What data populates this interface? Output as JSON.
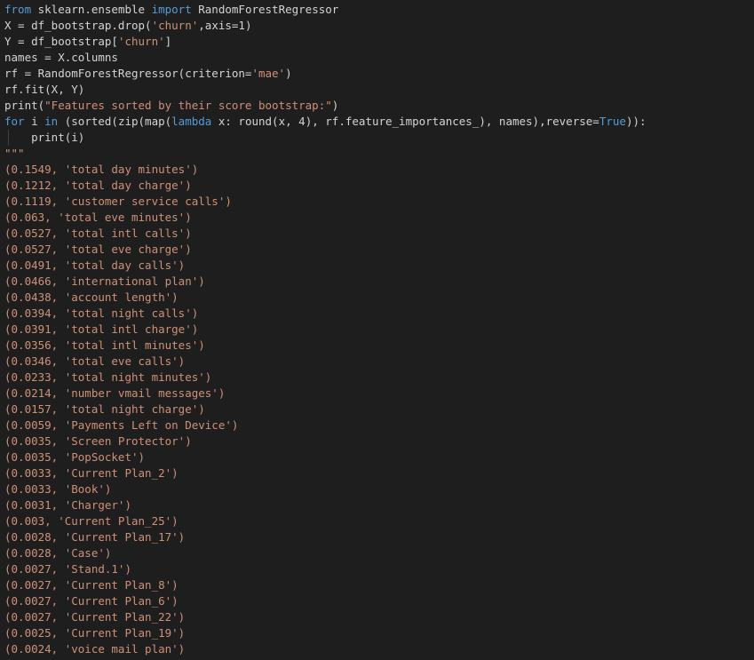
{
  "code": {
    "l1": {
      "kw1": "from",
      "mod": " sklearn.ensemble ",
      "kw2": "import",
      "name": " RandomForestRegressor"
    },
    "l2": {
      "a": "X = df_bootstrap.drop(",
      "s": "'churn'",
      "b": ",axis=",
      "n": "1",
      "c": ")"
    },
    "l3": {
      "a": "Y = df_bootstrap[",
      "s": "'churn'",
      "b": "]"
    },
    "l4": {
      "a": "names = X.columns"
    },
    "l5": {
      "a": "rf = RandomForestRegressor(criterion=",
      "s": "'mae'",
      "b": ")"
    },
    "l6": {
      "a": "rf.fit(X, Y)"
    },
    "l7": {
      "a": "print(",
      "s": "\"Features sorted by their score bootstrap:\"",
      "b": ")"
    },
    "l8": {
      "kw1": "for",
      "a": " i ",
      "kw2": "in",
      "b": " (sorted(zip(map(",
      "kw3": "lambda",
      "c": " x: round(x, ",
      "n": "4",
      "d": "), rf.feature_importances_), names),reverse=",
      "kw4": "True",
      "e": ")):"
    },
    "l9": {
      "a": "    print(i)"
    },
    "l10": {
      "s": "\"\"\""
    }
  },
  "output": [
    "(0.1549, 'total day minutes')",
    "(0.1212, 'total day charge')",
    "(0.1119, 'customer service calls')",
    "(0.063, 'total eve minutes')",
    "(0.0527, 'total intl calls')",
    "(0.0527, 'total eve charge')",
    "(0.0491, 'total day calls')",
    "(0.0466, 'international plan')",
    "(0.0438, 'account length')",
    "(0.0394, 'total night calls')",
    "(0.0391, 'total intl charge')",
    "(0.0356, 'total intl minutes')",
    "(0.0346, 'total eve calls')",
    "(0.0233, 'total night minutes')",
    "(0.0214, 'number vmail messages')",
    "(0.0157, 'total night charge')",
    "(0.0059, 'Payments Left on Device')",
    "(0.0035, 'Screen Protector')",
    "(0.0035, 'PopSocket')",
    "(0.0033, 'Current Plan_2')",
    "(0.0033, 'Book')",
    "(0.0031, 'Charger')",
    "(0.003, 'Current Plan_25')",
    "(0.0028, 'Current Plan_17')",
    "(0.0028, 'Case')",
    "(0.0027, 'Stand.1')",
    "(0.0027, 'Current Plan_8')",
    "(0.0027, 'Current Plan_6')",
    "(0.0027, 'Current Plan_22')",
    "(0.0025, 'Current Plan_19')",
    "(0.0024, 'voice mail plan')"
  ]
}
